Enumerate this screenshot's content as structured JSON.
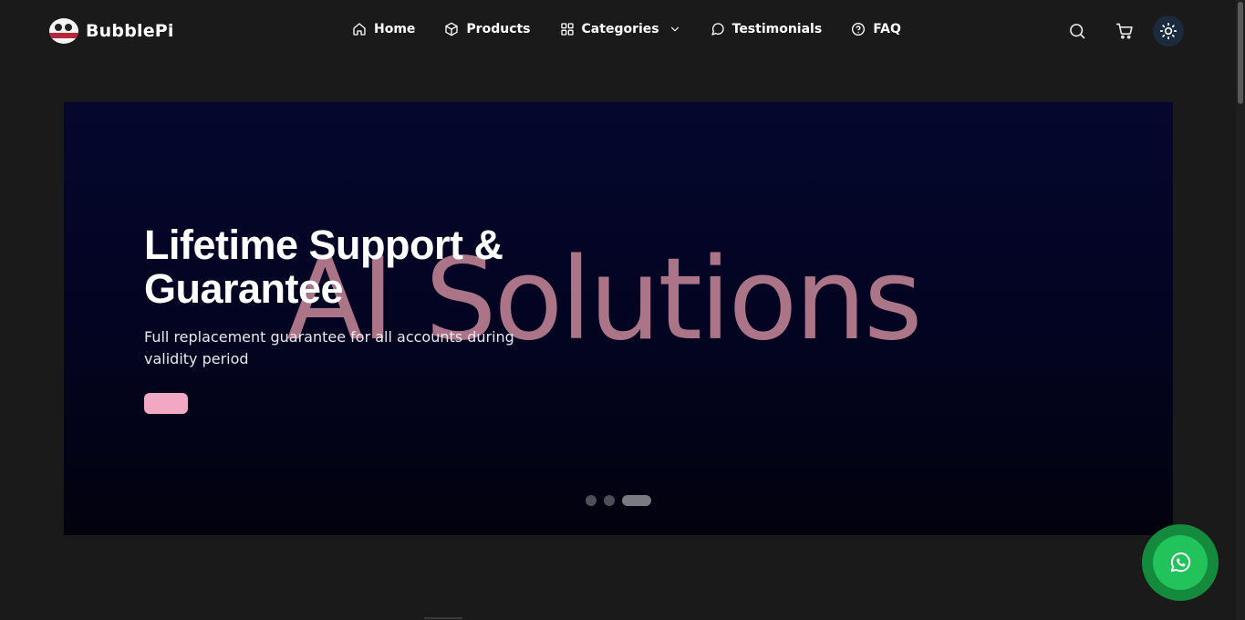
{
  "header": {
    "brand": "BubblePi",
    "logo_icon": "bubblepi-logo-icon",
    "nav": [
      {
        "label": "Home",
        "icon": "home-icon"
      },
      {
        "label": "Products",
        "icon": "box-icon"
      },
      {
        "label": "Categories",
        "icon": "grid-icon",
        "dropdown": true
      },
      {
        "label": "Testimonials",
        "icon": "chat-bubble-icon"
      },
      {
        "label": "FAQ",
        "icon": "help-circle-icon"
      }
    ],
    "icons": [
      "search-icon",
      "cart-icon",
      "sun-icon"
    ]
  },
  "hero": {
    "background_text": "AI Solutions",
    "title": "Lifetime Support & Guarantee",
    "subtitle": "Full replacement guarantee for all accounts during validity period",
    "button_label": "",
    "slides_count": 3,
    "active_slide": 3
  },
  "floating": {
    "whatsapp_icon": "whatsapp-icon"
  },
  "colors": {
    "page_bg": "#1b1a1a",
    "hero_bg": "#05072e",
    "accent_pink": "#f2a7c3",
    "whatsapp_green": "#22c35b",
    "bg_text": "#b87e8f"
  }
}
